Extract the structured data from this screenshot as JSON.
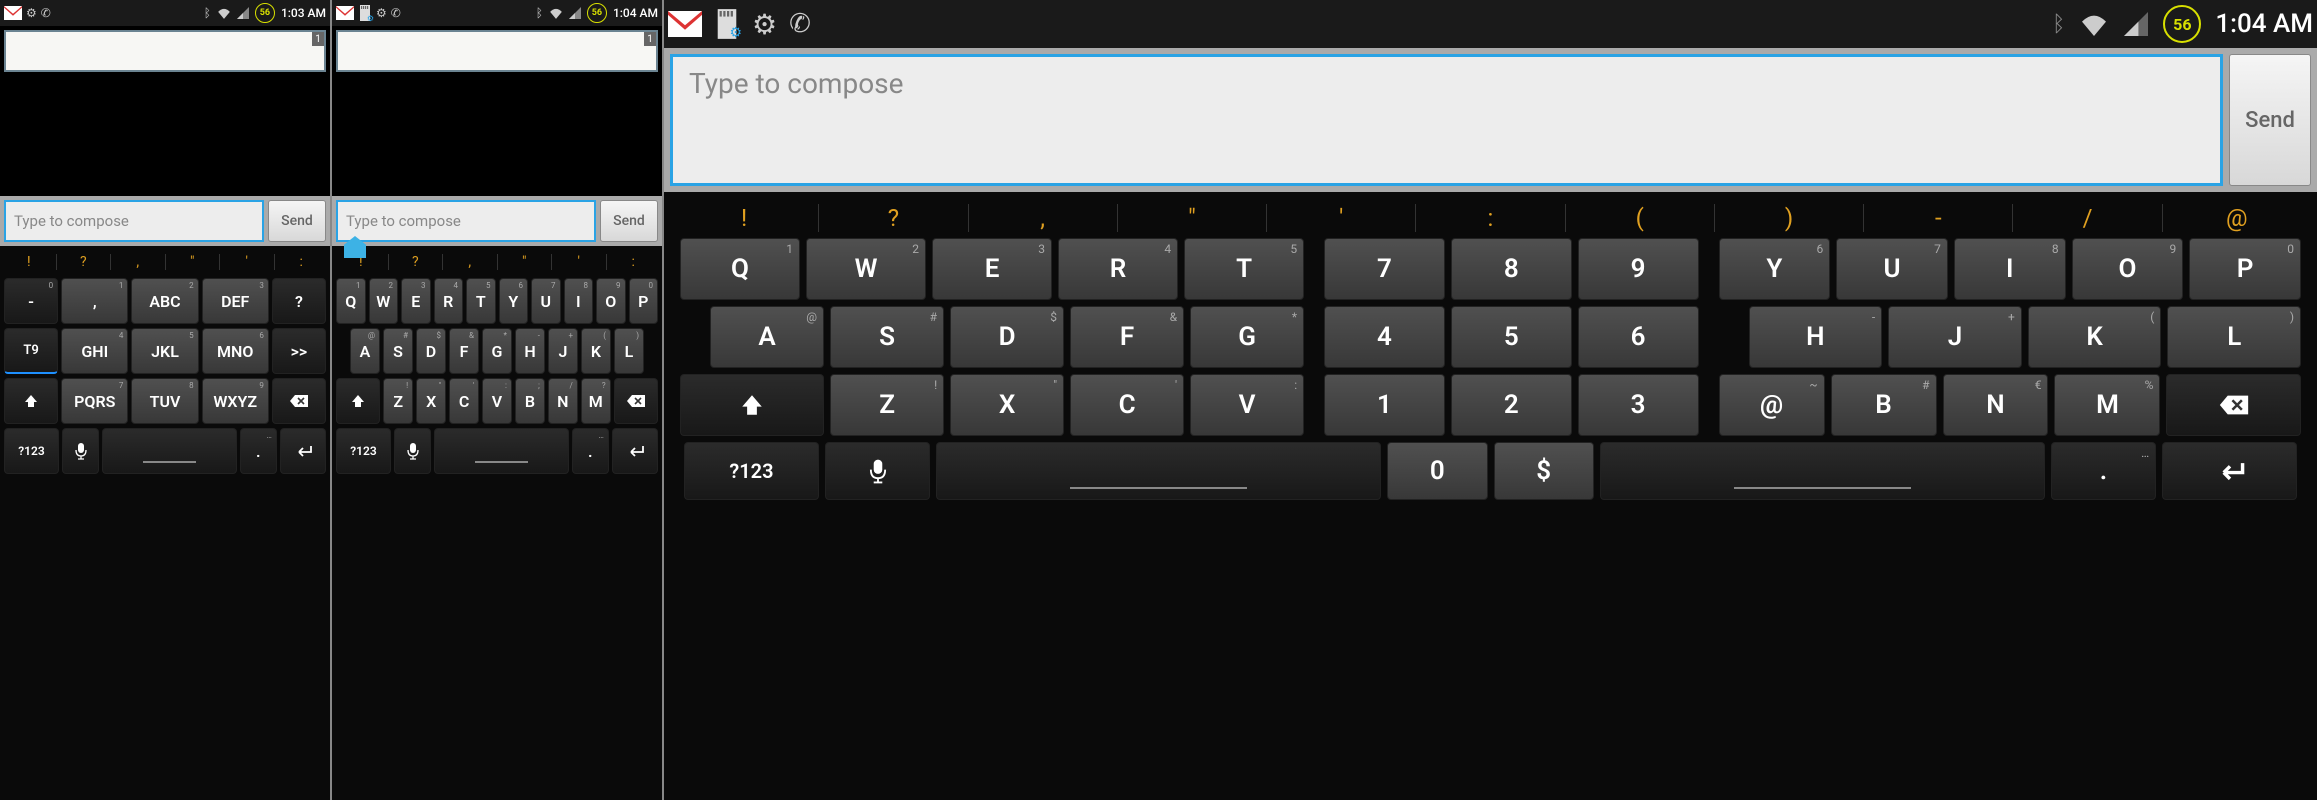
{
  "status": {
    "battery": "56",
    "time1": "1:03 AM",
    "time2": "1:04 AM",
    "time3": "1:04 AM",
    "recipient_tag": "1"
  },
  "compose": {
    "placeholder": "Type to compose",
    "send": "Send"
  },
  "symbols_small": [
    "!",
    "?",
    ",",
    "\"",
    "'",
    ":"
  ],
  "symbols_big": [
    "!",
    "?",
    ",",
    "\"",
    "'",
    ":",
    "(",
    ")",
    "-",
    "/",
    "@"
  ],
  "t9": {
    "r1": [
      {
        "main": "-",
        "sub": "0"
      },
      {
        "main": ",",
        "sub": "1"
      },
      {
        "main": "ABC",
        "sub": "2"
      },
      {
        "main": "DEF",
        "sub": "3"
      },
      {
        "main": "?",
        "sub": ""
      }
    ],
    "r2": [
      {
        "main": "T9",
        "sub": ""
      },
      {
        "main": "GHI",
        "sub": "4"
      },
      {
        "main": "JKL",
        "sub": "5"
      },
      {
        "main": "MNO",
        "sub": "6"
      },
      {
        "main": ">>",
        "sub": ""
      }
    ],
    "r3": [
      {
        "main": "⇧",
        "sub": ""
      },
      {
        "main": "PQRS",
        "sub": "7"
      },
      {
        "main": "TUV",
        "sub": "8"
      },
      {
        "main": "WXYZ",
        "sub": "9"
      },
      {
        "main": "⌫",
        "sub": ""
      }
    ]
  },
  "qwerty_small": {
    "r1": [
      {
        "main": "Q",
        "sub": "1"
      },
      {
        "main": "W",
        "sub": "2"
      },
      {
        "main": "E",
        "sub": "3"
      },
      {
        "main": "R",
        "sub": "4"
      },
      {
        "main": "T",
        "sub": "5"
      },
      {
        "main": "Y",
        "sub": "6"
      },
      {
        "main": "U",
        "sub": "7"
      },
      {
        "main": "I",
        "sub": "8"
      },
      {
        "main": "O",
        "sub": "9"
      },
      {
        "main": "P",
        "sub": "0"
      }
    ],
    "r2": [
      {
        "main": "A",
        "sub": "@"
      },
      {
        "main": "S",
        "sub": "#"
      },
      {
        "main": "D",
        "sub": "$"
      },
      {
        "main": "F",
        "sub": "&"
      },
      {
        "main": "G",
        "sub": "*"
      },
      {
        "main": "H",
        "sub": "-"
      },
      {
        "main": "J",
        "sub": "+"
      },
      {
        "main": "K",
        "sub": "("
      },
      {
        "main": "L",
        "sub": ")"
      }
    ],
    "r3": [
      {
        "main": "Z",
        "sub": "!"
      },
      {
        "main": "X",
        "sub": "\""
      },
      {
        "main": "C",
        "sub": "'"
      },
      {
        "main": "V",
        "sub": ":"
      },
      {
        "main": "B",
        "sub": ";"
      },
      {
        "main": "N",
        "sub": "/"
      },
      {
        "main": "M",
        "sub": "?"
      }
    ]
  },
  "bottom": {
    "mode": "?123",
    "mic": "🎤",
    "period": ".",
    "enter": "↵"
  },
  "kb3": {
    "left_r1": [
      {
        "main": "Q",
        "sub": "1"
      },
      {
        "main": "W",
        "sub": "2"
      },
      {
        "main": "E",
        "sub": "3"
      },
      {
        "main": "R",
        "sub": "4"
      },
      {
        "main": "T",
        "sub": "5"
      }
    ],
    "left_r2": [
      {
        "main": "A",
        "sub": "@"
      },
      {
        "main": "S",
        "sub": "#"
      },
      {
        "main": "D",
        "sub": "$"
      },
      {
        "main": "F",
        "sub": "&"
      },
      {
        "main": "G",
        "sub": "*"
      }
    ],
    "left_r3": [
      {
        "main": "Z",
        "sub": "!"
      },
      {
        "main": "X",
        "sub": "\""
      },
      {
        "main": "C",
        "sub": "'"
      },
      {
        "main": "V",
        "sub": ":"
      }
    ],
    "mid_r1": [
      {
        "main": "7",
        "sub": ""
      },
      {
        "main": "8",
        "sub": ""
      },
      {
        "main": "9",
        "sub": ""
      }
    ],
    "mid_r2": [
      {
        "main": "4",
        "sub": ""
      },
      {
        "main": "5",
        "sub": ""
      },
      {
        "main": "6",
        "sub": ""
      }
    ],
    "mid_r3": [
      {
        "main": "1",
        "sub": ""
      },
      {
        "main": "2",
        "sub": ""
      },
      {
        "main": "3",
        "sub": ""
      }
    ],
    "right_r1": [
      {
        "main": "Y",
        "sub": "6"
      },
      {
        "main": "U",
        "sub": "7"
      },
      {
        "main": "I",
        "sub": "8"
      },
      {
        "main": "O",
        "sub": "9"
      },
      {
        "main": "P",
        "sub": "0"
      }
    ],
    "right_r2": [
      {
        "main": "H",
        "sub": "-"
      },
      {
        "main": "J",
        "sub": "+"
      },
      {
        "main": "K",
        "sub": "("
      },
      {
        "main": "L",
        "sub": ")"
      }
    ],
    "right_r3": [
      {
        "main": "@",
        "sub": "~"
      },
      {
        "main": "B",
        "sub": "#"
      },
      {
        "main": "N",
        "sub": "€"
      },
      {
        "main": "M",
        "sub": "%"
      }
    ],
    "bottom_mid": [
      {
        "main": "0",
        "sub": ""
      },
      {
        "main": "$",
        "sub": ""
      }
    ]
  }
}
